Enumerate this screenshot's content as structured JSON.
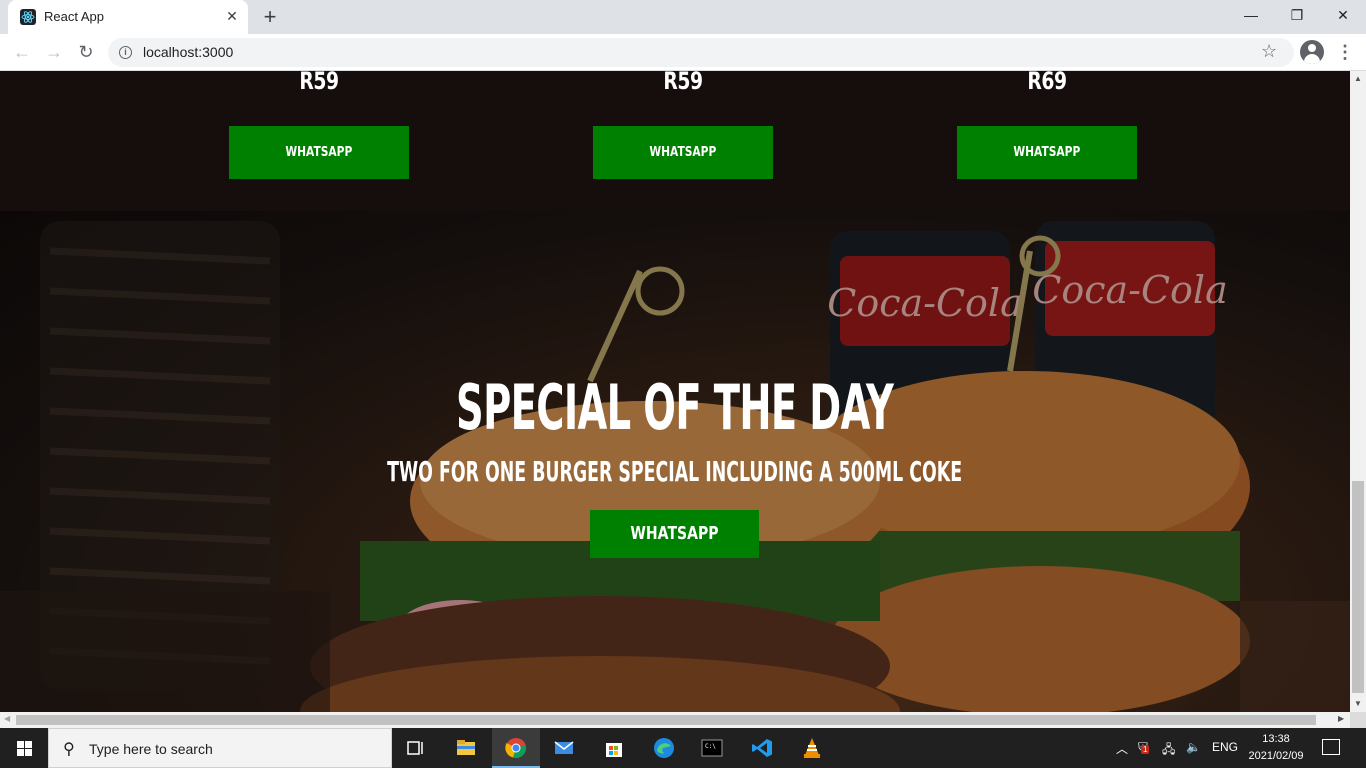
{
  "browser": {
    "tab_title": "React App",
    "tab_close": "✕",
    "new_tab": "+",
    "url": "localhost:3000",
    "window": {
      "minimize": "—",
      "maximize": "❐",
      "close": "✕"
    },
    "nav": {
      "back": "←",
      "forward": "→",
      "reload": "↻"
    },
    "icons": [
      "react-favicon",
      "info-icon",
      "star-icon",
      "profile-icon",
      "menu-icon"
    ]
  },
  "menu_items": [
    {
      "price": "R59",
      "button": "WHATSAPP"
    },
    {
      "price": "R59",
      "button": "WHATSAPP"
    },
    {
      "price": "R69",
      "button": "WHATSAPP"
    }
  ],
  "hero": {
    "title": "SPECIAL OF THE DAY",
    "subtitle": "TWO FOR ONE BURGER SPECIAL INCLUDING A 500ML COKE",
    "button": "WHATSAPP"
  },
  "colors": {
    "button_green": "#008000",
    "dark_band": "#150e0d",
    "taskbar": "#202020"
  },
  "taskbar": {
    "search_placeholder": "Type here to search",
    "apps": [
      "task-view",
      "file-explorer",
      "chrome",
      "mail",
      "microsoft-store",
      "edge",
      "terminal",
      "vs-code",
      "vlc"
    ],
    "language": "ENG",
    "time": "13:38",
    "date": "2021/02/09",
    "notification_badge": "1"
  }
}
